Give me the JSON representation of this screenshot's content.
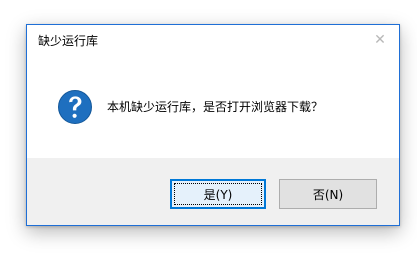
{
  "dialog": {
    "title": "缺少运行库",
    "close_label": "✕",
    "message": "本机缺少运行库，是否打开浏览器下载？",
    "icon": "question-icon",
    "buttons": {
      "yes": "是(Y)",
      "no": "否(N)"
    }
  },
  "colors": {
    "icon_blue": "#1e6fbf",
    "focus_border": "#0078d7",
    "footer_bg": "#f0f0f0"
  }
}
